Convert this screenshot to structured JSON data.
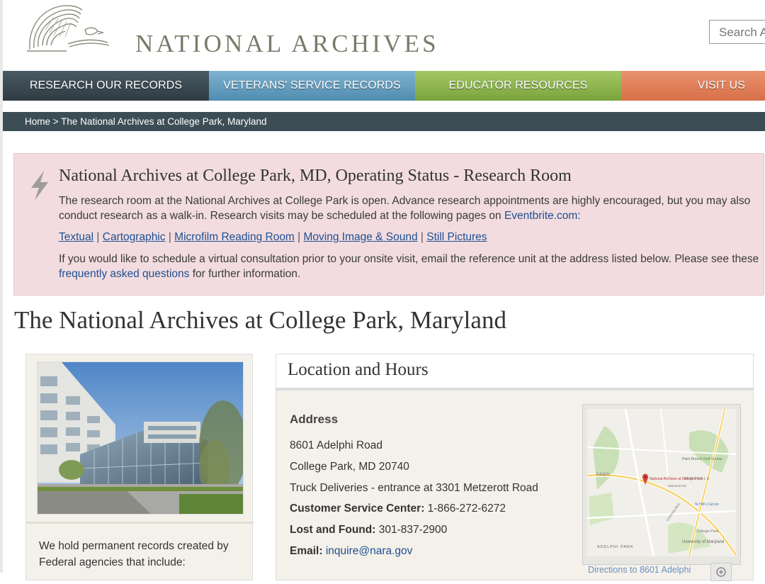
{
  "header": {
    "logo_text": "NATIONAL ARCHIVES",
    "search_placeholder": "Search Archives"
  },
  "nav": {
    "items": [
      {
        "label": "RESEARCH OUR RECORDS"
      },
      {
        "label": "VETERANS' SERVICE RECORDS"
      },
      {
        "label": "EDUCATOR RESOURCES"
      },
      {
        "label": "VISIT US"
      }
    ]
  },
  "breadcrumb": {
    "home": "Home",
    "separator": " > ",
    "current": "The National Archives at College Park, Maryland"
  },
  "alert": {
    "title": "National Archives at College Park, MD, Operating Status - Research Room",
    "p1_text": "The research room at the National Archives at College Park is open. Advance research appointments are highly encouraged, but you may also conduct research as a walk-in. Research visits may be scheduled at the following pages on ",
    "p1_link": "Eventbrite.com",
    "p1_end": ":",
    "links": [
      "Textual",
      "Cartographic",
      "Microfilm Reading Room",
      "Moving Image & Sound",
      "Still Pictures"
    ],
    "link_sep": " | ",
    "p3_text": "If you would like to schedule a virtual consultation prior to your onsite visit, email the reference unit at the address listed below. Please see these ",
    "p3_link": "frequently asked questions",
    "p3_end": " for further information."
  },
  "page_title": "The National Archives at College Park, Maryland",
  "left_card": {
    "text": "We hold permanent records created by Federal agencies that include:"
  },
  "location": {
    "heading": "Location and Hours",
    "address_label": "Address",
    "street": "8601 Adelphi Road",
    "city": "College Park, MD  20740",
    "truck": "Truck Deliveries - entrance at 3301 Metzerott Road",
    "csc_label": "Customer Service Center:",
    "csc_value": " 1-866-272-6272",
    "lost_label": "Lost and Found:",
    "lost_value": " 301-837-2900",
    "email_label": "Email:",
    "email_value": "inquire@nara.gov",
    "map_link": "Directions to 8601 Adelphi"
  },
  "map": {
    "marker_label": "National Archives at College Park",
    "labels": [
      "Adelphi",
      "ADELPHI PARK",
      "ACREDALE",
      "University of Maryland",
      "College Park",
      "Paint Branch Golf Course",
      "St Hill's Cancer",
      "Metzerott Rd",
      "University Blvd"
    ]
  },
  "colors": {
    "nav_research": "#3a4850",
    "nav_veterans": "#62a0c4",
    "nav_educator": "#8fb650",
    "nav_visit": "#e07d56",
    "breadcrumb_bg": "#3c4d55",
    "alert_bg": "#f2dcdf",
    "link": "#1f4f93"
  }
}
